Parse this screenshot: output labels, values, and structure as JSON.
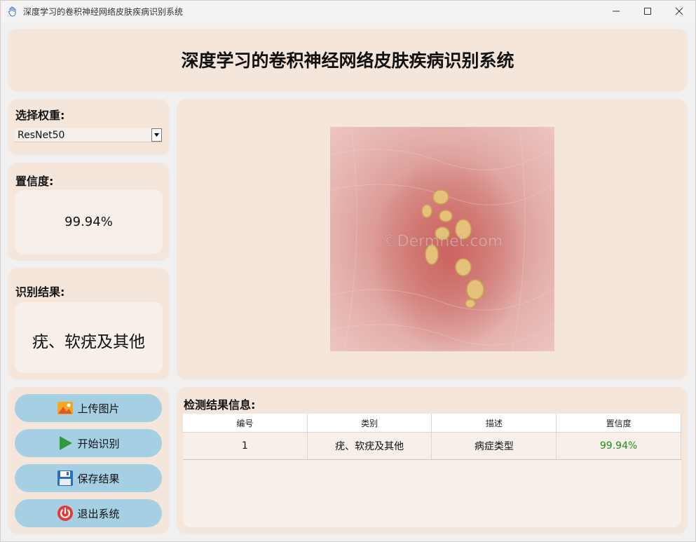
{
  "window": {
    "title": "深度学习的卷积神经网络皮肤疾病识别系统"
  },
  "header": {
    "title": "深度学习的卷积神经网络皮肤疾病识别系统"
  },
  "weights": {
    "label": "选择权重:",
    "selected": "ResNet50"
  },
  "confidence": {
    "label": "置信度:",
    "value": "99.94%"
  },
  "result": {
    "label": "识别结果:",
    "value": "疣、软疣及其他"
  },
  "image": {
    "watermark": "©Dermnet.com"
  },
  "buttons": {
    "upload": "上传图片",
    "start": "开始识别",
    "save": "保存结果",
    "exit": "退出系统"
  },
  "detection": {
    "label": "检测结果信息:",
    "columns": [
      "编号",
      "类别",
      "描述",
      "置信度"
    ],
    "rows": [
      [
        "1",
        "疣、软疣及其他",
        "病症类型",
        "99.94%"
      ]
    ]
  },
  "colors": {
    "panel": "#f5e6dc",
    "button": "#a5cfe3",
    "confidence_text": "#1e8a1e"
  }
}
